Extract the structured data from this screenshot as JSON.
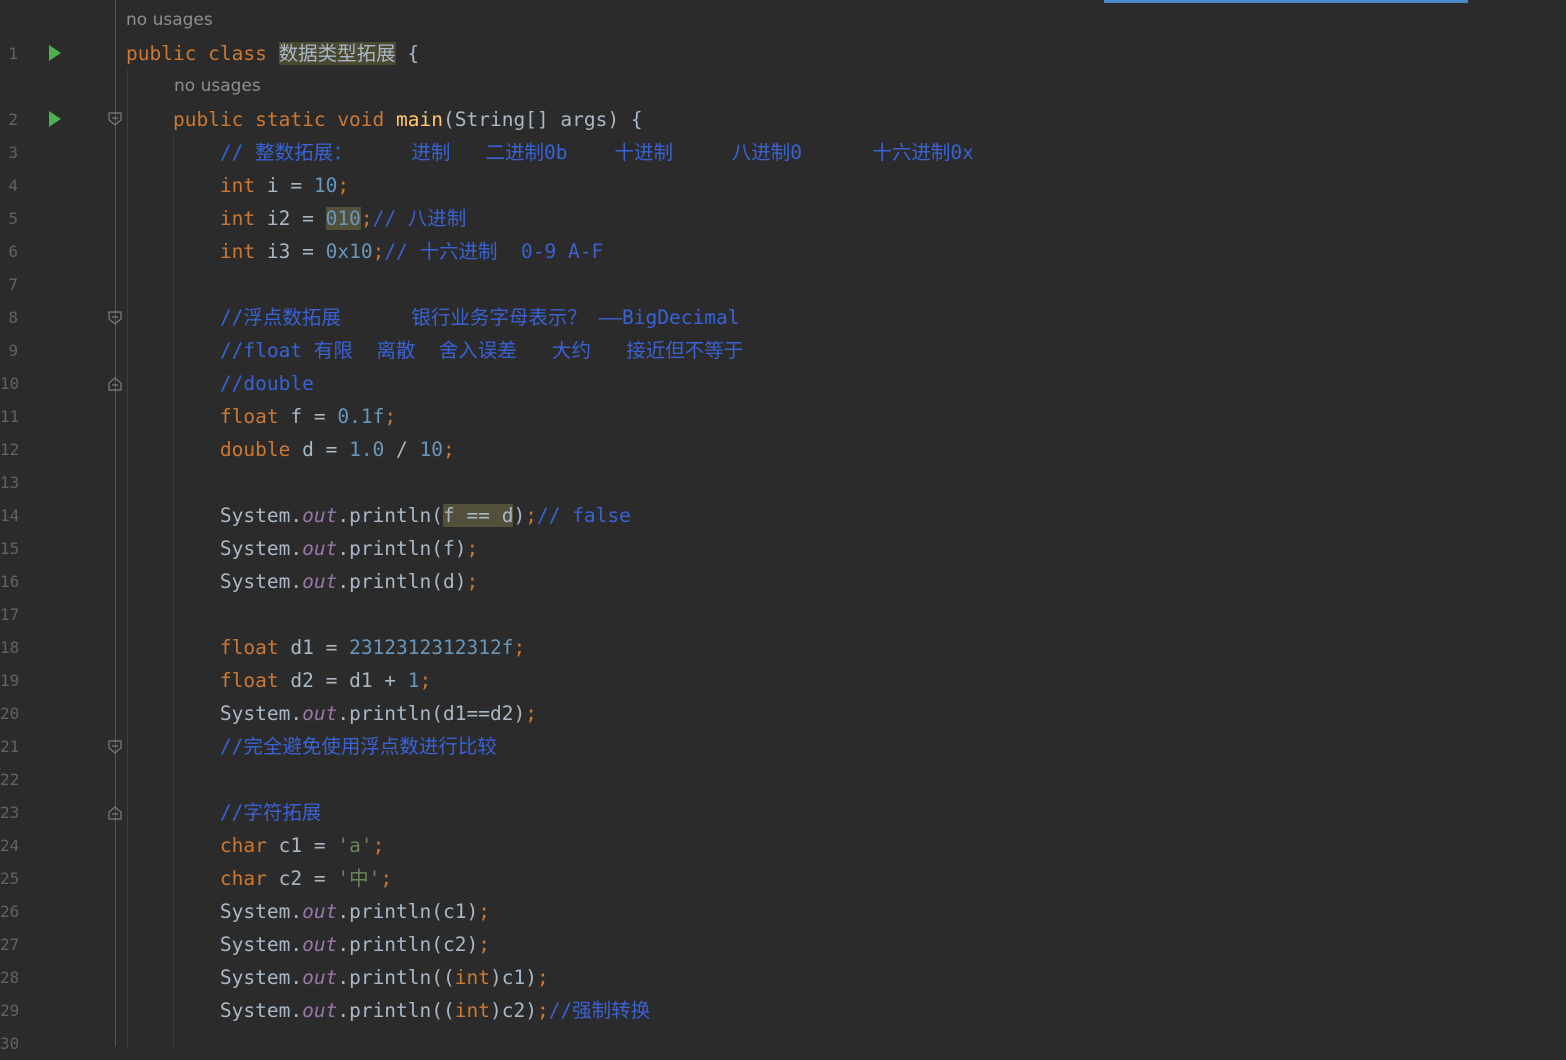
{
  "editor": {
    "inlay_hints": {
      "class_usages": "no usages",
      "main_usages": "no usages"
    },
    "line_numbers": [
      "1",
      "2",
      "3",
      "4",
      "5",
      "6",
      "7",
      "8",
      "9",
      "10",
      "11",
      "12",
      "13",
      "14",
      "15",
      "16",
      "17",
      "18",
      "19",
      "20",
      "21",
      "22",
      "23",
      "24",
      "25",
      "26",
      "27",
      "28",
      "29",
      "30"
    ],
    "colors": {
      "background": "#2b2b2b",
      "keyword": "#cc7832",
      "method_declaration": "#ffc66d",
      "identifier": "#a9b7c6",
      "number": "#6897bb",
      "string": "#6a8759",
      "comment": "#3a62d4",
      "static_field": "#9876aa",
      "run_icon": "#4caf50",
      "accent": "#4a88c7"
    },
    "lines": [
      {
        "num": "1",
        "tokens": [
          {
            "t": "public class ",
            "c": "kw"
          },
          {
            "t": "数据类型拓展",
            "c": "plain hl-name"
          },
          {
            "t": " {",
            "c": "plain"
          }
        ]
      },
      {
        "num": "2",
        "tokens": [
          {
            "t": "    public static void ",
            "c": "kw"
          },
          {
            "t": "main",
            "c": "fn"
          },
          {
            "t": "(String[] args) {",
            "c": "plain"
          }
        ]
      },
      {
        "num": "3",
        "tokens": [
          {
            "t": "        // 整数拓展：     进制   二进制0b    十进制     八进制0      十六进制0x",
            "c": "cm"
          }
        ]
      },
      {
        "num": "4",
        "tokens": [
          {
            "t": "        int ",
            "c": "kw"
          },
          {
            "t": "i = ",
            "c": "plain"
          },
          {
            "t": "10",
            "c": "num"
          },
          {
            "t": ";",
            "c": "kw"
          }
        ]
      },
      {
        "num": "5",
        "tokens": [
          {
            "t": "        int ",
            "c": "kw"
          },
          {
            "t": "i2 = ",
            "c": "plain"
          },
          {
            "t": "010",
            "c": "num hl"
          },
          {
            "t": ";",
            "c": "kw"
          },
          {
            "t": "// 八进制",
            "c": "cm"
          }
        ]
      },
      {
        "num": "6",
        "tokens": [
          {
            "t": "        int ",
            "c": "kw"
          },
          {
            "t": "i3 = ",
            "c": "plain"
          },
          {
            "t": "0x10",
            "c": "num"
          },
          {
            "t": ";",
            "c": "kw"
          },
          {
            "t": "// 十六进制  0-9 A-F",
            "c": "cm"
          }
        ]
      },
      {
        "num": "7",
        "tokens": []
      },
      {
        "num": "8",
        "tokens": [
          {
            "t": "        //浮点数拓展      银行业务字母表示？ ——BigDecimal",
            "c": "cm"
          }
        ]
      },
      {
        "num": "9",
        "tokens": [
          {
            "t": "        //float 有限  离散  舍入误差   大约   接近但不等于",
            "c": "cm"
          }
        ]
      },
      {
        "num": "10",
        "tokens": [
          {
            "t": "        //double",
            "c": "cm"
          }
        ]
      },
      {
        "num": "11",
        "tokens": [
          {
            "t": "        float ",
            "c": "kw"
          },
          {
            "t": "f = ",
            "c": "plain"
          },
          {
            "t": "0.1f",
            "c": "num"
          },
          {
            "t": ";",
            "c": "kw"
          }
        ]
      },
      {
        "num": "12",
        "tokens": [
          {
            "t": "        double ",
            "c": "kw"
          },
          {
            "t": "d = ",
            "c": "plain"
          },
          {
            "t": "1.0",
            "c": "num"
          },
          {
            "t": " / ",
            "c": "plain"
          },
          {
            "t": "10",
            "c": "num"
          },
          {
            "t": ";",
            "c": "kw"
          }
        ]
      },
      {
        "num": "13",
        "tokens": []
      },
      {
        "num": "14",
        "tokens": [
          {
            "t": "        System.",
            "c": "plain"
          },
          {
            "t": "out",
            "c": "field"
          },
          {
            "t": ".println(",
            "c": "plain"
          },
          {
            "t": "f == d",
            "c": "plain hl"
          },
          {
            "t": ")",
            "c": "plain"
          },
          {
            "t": ";",
            "c": "kw"
          },
          {
            "t": "// false",
            "c": "cm"
          }
        ]
      },
      {
        "num": "15",
        "tokens": [
          {
            "t": "        System.",
            "c": "plain"
          },
          {
            "t": "out",
            "c": "field"
          },
          {
            "t": ".println(f)",
            "c": "plain"
          },
          {
            "t": ";",
            "c": "kw"
          }
        ]
      },
      {
        "num": "16",
        "tokens": [
          {
            "t": "        System.",
            "c": "plain"
          },
          {
            "t": "out",
            "c": "field"
          },
          {
            "t": ".println(d)",
            "c": "plain"
          },
          {
            "t": ";",
            "c": "kw"
          }
        ]
      },
      {
        "num": "17",
        "tokens": []
      },
      {
        "num": "18",
        "tokens": [
          {
            "t": "        float ",
            "c": "kw"
          },
          {
            "t": "d1 = ",
            "c": "plain"
          },
          {
            "t": "2312312312312f",
            "c": "num"
          },
          {
            "t": ";",
            "c": "kw"
          }
        ]
      },
      {
        "num": "19",
        "tokens": [
          {
            "t": "        float ",
            "c": "kw"
          },
          {
            "t": "d2 = d1 + ",
            "c": "plain"
          },
          {
            "t": "1",
            "c": "num"
          },
          {
            "t": ";",
            "c": "kw"
          }
        ]
      },
      {
        "num": "20",
        "tokens": [
          {
            "t": "        System.",
            "c": "plain"
          },
          {
            "t": "out",
            "c": "field"
          },
          {
            "t": ".println(d1==d2)",
            "c": "plain"
          },
          {
            "t": ";",
            "c": "kw"
          }
        ]
      },
      {
        "num": "21",
        "tokens": [
          {
            "t": "        //完全避免使用浮点数进行比较",
            "c": "cm"
          }
        ]
      },
      {
        "num": "22",
        "tokens": []
      },
      {
        "num": "23",
        "tokens": [
          {
            "t": "        //字符拓展",
            "c": "cm"
          }
        ]
      },
      {
        "num": "24",
        "tokens": [
          {
            "t": "        char ",
            "c": "kw"
          },
          {
            "t": "c1 = ",
            "c": "plain"
          },
          {
            "t": "'a'",
            "c": "str"
          },
          {
            "t": ";",
            "c": "kw"
          }
        ]
      },
      {
        "num": "25",
        "tokens": [
          {
            "t": "        char ",
            "c": "kw"
          },
          {
            "t": "c2 = ",
            "c": "plain"
          },
          {
            "t": "'中'",
            "c": "str"
          },
          {
            "t": ";",
            "c": "kw"
          }
        ]
      },
      {
        "num": "26",
        "tokens": [
          {
            "t": "        System.",
            "c": "plain"
          },
          {
            "t": "out",
            "c": "field"
          },
          {
            "t": ".println(c1)",
            "c": "plain"
          },
          {
            "t": ";",
            "c": "kw"
          }
        ]
      },
      {
        "num": "27",
        "tokens": [
          {
            "t": "        System.",
            "c": "plain"
          },
          {
            "t": "out",
            "c": "field"
          },
          {
            "t": ".println(c2)",
            "c": "plain"
          },
          {
            "t": ";",
            "c": "kw"
          }
        ]
      },
      {
        "num": "28",
        "tokens": [
          {
            "t": "        System.",
            "c": "plain"
          },
          {
            "t": "out",
            "c": "field"
          },
          {
            "t": ".println((",
            "c": "plain"
          },
          {
            "t": "int",
            "c": "kw"
          },
          {
            "t": ")c1)",
            "c": "plain"
          },
          {
            "t": ";",
            "c": "kw"
          }
        ]
      },
      {
        "num": "29",
        "tokens": [
          {
            "t": "        System.",
            "c": "plain"
          },
          {
            "t": "out",
            "c": "field"
          },
          {
            "t": ".println((",
            "c": "plain"
          },
          {
            "t": "int",
            "c": "kw"
          },
          {
            "t": ")c2)",
            "c": "plain"
          },
          {
            "t": ";",
            "c": "kw"
          },
          {
            "t": "//强制转换",
            "c": "cm"
          }
        ]
      },
      {
        "num": "30",
        "tokens": []
      }
    ]
  }
}
